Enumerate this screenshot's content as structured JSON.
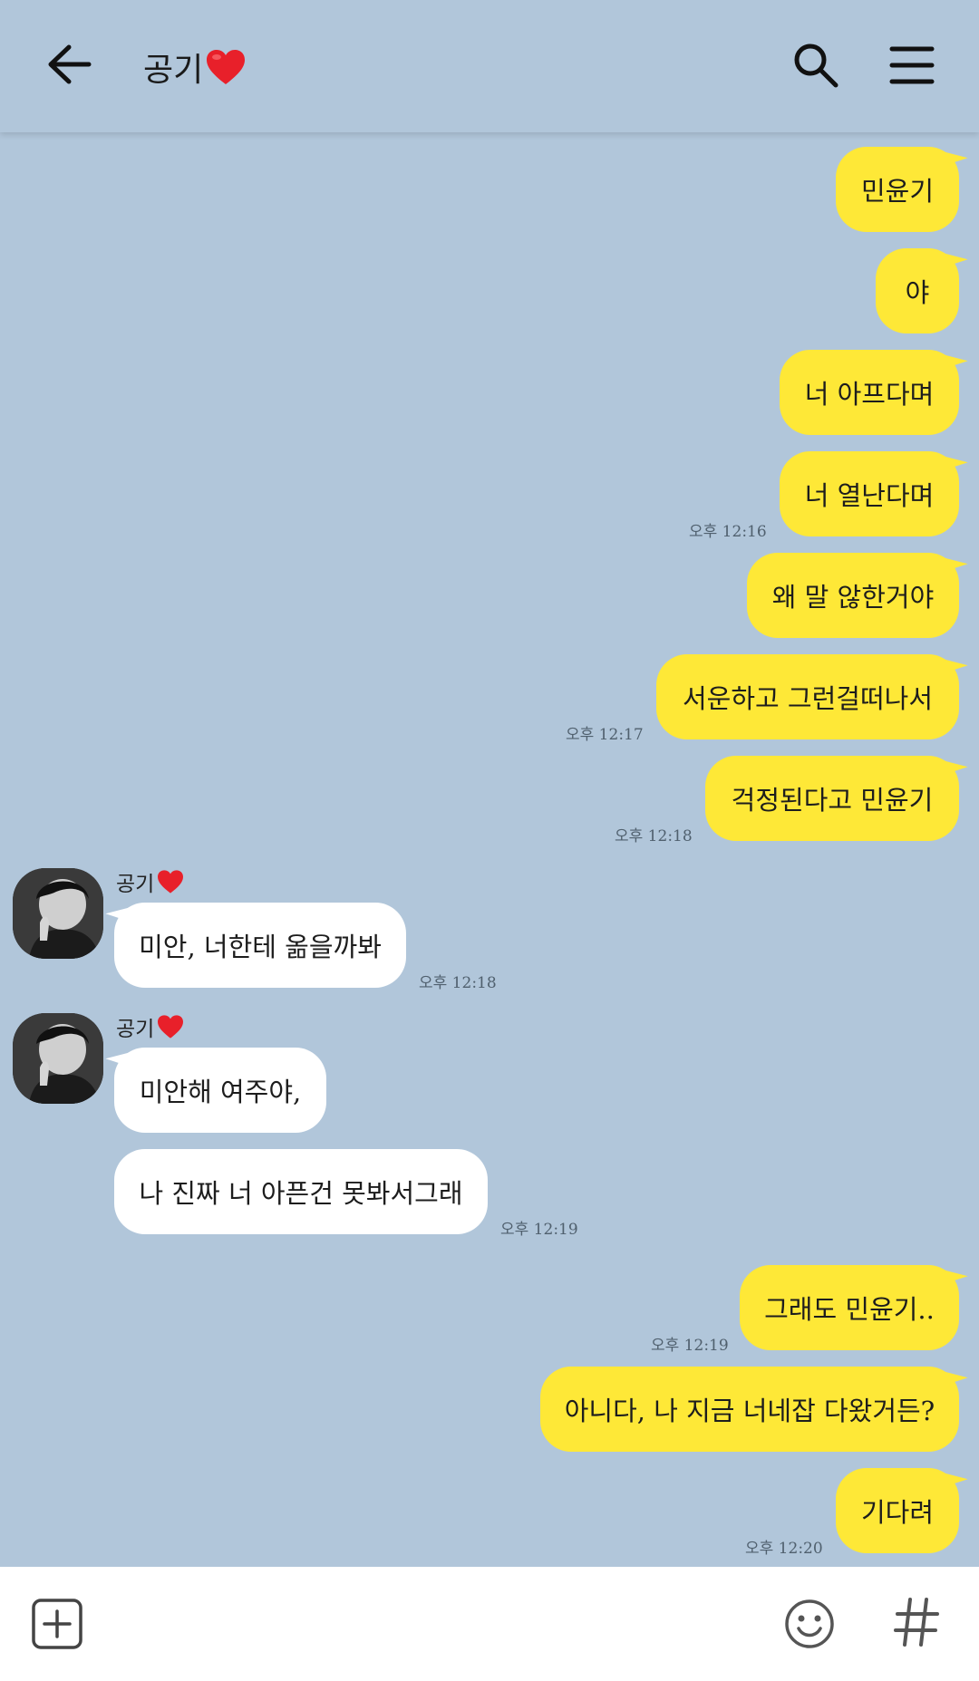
{
  "header": {
    "title": "공기",
    "title_emoji": "heart-emoji",
    "icons": [
      "back-arrow-icon",
      "search-icon",
      "menu-icon"
    ]
  },
  "messages": [
    {
      "side": "me",
      "text": "민윤기"
    },
    {
      "side": "me",
      "text": "야"
    },
    {
      "side": "me",
      "text": "너 아프다며"
    },
    {
      "side": "me",
      "text": "너 열난다며",
      "time": "오후 12:16"
    },
    {
      "side": "me",
      "text": "왜 말 않한거야"
    },
    {
      "side": "me",
      "text": "서운하고 그런걸떠나서",
      "time": "오후 12:17"
    },
    {
      "side": "me",
      "text": "걱정된다고 민윤기",
      "time": "오후 12:18"
    },
    {
      "side": "them",
      "sender": "공기",
      "text": "미안, 너한테 옮을까봐",
      "time": "오후 12:18"
    },
    {
      "side": "them",
      "sender": "공기",
      "text": "미안해 여주야,"
    },
    {
      "side": "them",
      "text": "나 진짜 너 아픈건 못봐서그래",
      "time": "오후 12:19"
    },
    {
      "side": "me",
      "text": "그래도 민윤기..",
      "time": "오후 12:19"
    },
    {
      "side": "me",
      "text": "아니다, 나 지금 너네잡 다왔거든?"
    },
    {
      "side": "me",
      "text": "기다려",
      "time": "오후 12:20"
    }
  ],
  "colors": {
    "background": "#b1c6da",
    "my_bubble": "#fee837",
    "their_bubble": "#ffffff",
    "time_text": "#50606e"
  },
  "input_bar": {
    "icons": [
      "plus-icon",
      "emoji-icon",
      "hashtag-icon"
    ]
  }
}
